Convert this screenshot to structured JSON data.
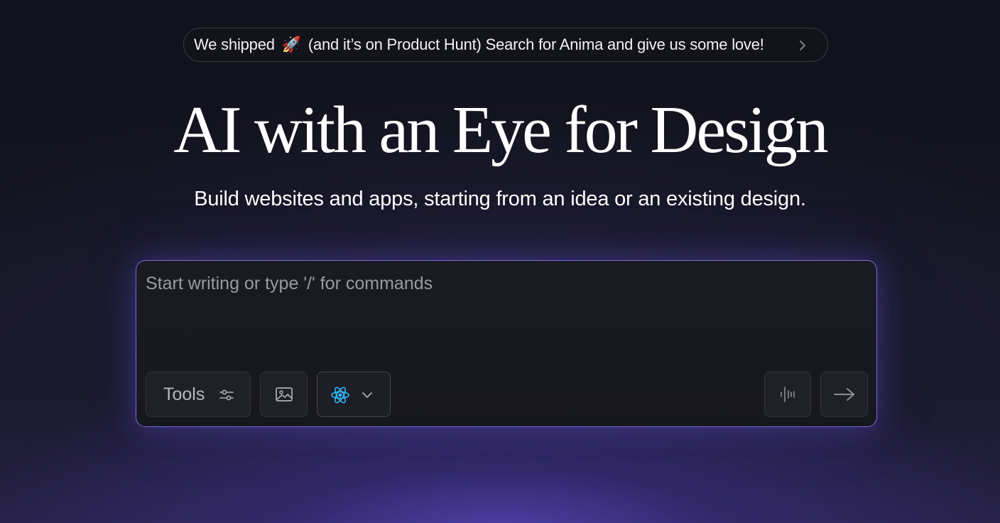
{
  "announcement": {
    "text_before": "We shipped",
    "emoji": "🚀",
    "text_after": "(and it’s on Product Hunt) Search for Anima and give us some love!",
    "icon": "chevron-right-icon"
  },
  "hero": {
    "title": "AI with an Eye for Design",
    "subtitle": "Build websites and apps, starting from an idea or an existing design."
  },
  "prompt": {
    "placeholder": "Start writing or type '/' for commands",
    "value": "",
    "tools_label": "Tools",
    "tools_icon": "sliders-icon",
    "image_icon": "image-icon",
    "framework_icon": "react-icon",
    "framework_dropdown_icon": "chevron-down-icon",
    "voice_icon": "audio-waveform-icon",
    "send_icon": "arrow-right-icon"
  },
  "colors": {
    "accent_border": "#7b6ae0",
    "react_blue": "#2fb7f2",
    "background_top": "#12121c",
    "glow_bottom": "#5846be"
  }
}
